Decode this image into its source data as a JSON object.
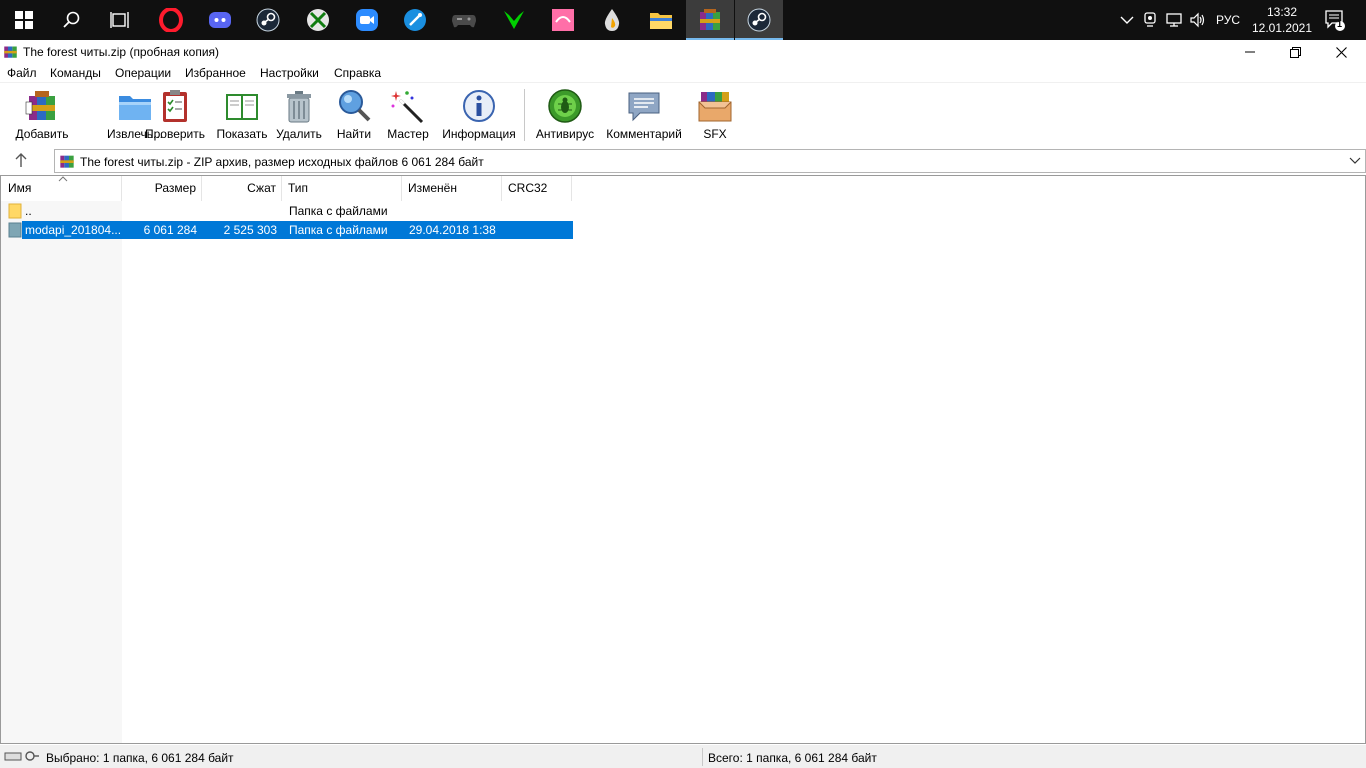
{
  "taskbar": {
    "apps": [
      {
        "name": "Opera",
        "color": "#ff1b2d"
      },
      {
        "name": "Discord",
        "color": "#5865f2"
      },
      {
        "name": "Steam",
        "color": "#1b2838"
      },
      {
        "name": "Xbox",
        "color": "#3a3a3a"
      },
      {
        "name": "Zoom",
        "color": "#2d8cff"
      },
      {
        "name": "Paint",
        "color": "#1a6ec2"
      },
      {
        "name": "Gamepad",
        "color": "#3a3a3a"
      },
      {
        "name": "Razer",
        "color": "#00c800"
      },
      {
        "name": "Chrome-alt",
        "color": "#ff66aa"
      },
      {
        "name": "Drop",
        "color": "#e8e8e8"
      },
      {
        "name": "Explorer",
        "color": "#f5c342"
      },
      {
        "name": "WinRAR",
        "color": "#8a2c8a"
      },
      {
        "name": "Steam",
        "color": "#1b2838"
      }
    ],
    "lang": "РУС",
    "time": "13:32",
    "date": "12.01.2021",
    "notif_count": "1"
  },
  "window": {
    "title": "The forest читы.zip (пробная копия)"
  },
  "menu": [
    "Файл",
    "Команды",
    "Операции",
    "Избранное",
    "Настройки",
    "Справка"
  ],
  "toolbar": [
    {
      "label": "Добавить",
      "icon": "add-archive-icon"
    },
    {
      "label": "Извлечь...",
      "icon": "extract-folder-icon"
    },
    {
      "label": "Проверить",
      "icon": "test-clipboard-icon"
    },
    {
      "label": "Показать",
      "icon": "view-book-icon"
    },
    {
      "label": "Удалить",
      "icon": "trash-icon"
    },
    {
      "label": "Найти",
      "icon": "magnifier-icon"
    },
    {
      "label": "Мастер",
      "icon": "wizard-wand-icon"
    },
    {
      "label": "Информация",
      "icon": "info-icon"
    },
    {
      "label": "Антивирус",
      "icon": "antivirus-bug-icon"
    },
    {
      "label": "Комментарий",
      "icon": "comment-icon"
    },
    {
      "label": "SFX",
      "icon": "sfx-box-icon"
    }
  ],
  "address": {
    "path": "The forest читы.zip - ZIP архив, размер исходных файлов 6 061 284 байт"
  },
  "columns": [
    "Имя",
    "Размер",
    "Сжат",
    "Тип",
    "Изменён",
    "CRC32"
  ],
  "rows": [
    {
      "name": "..",
      "size": "",
      "packed": "",
      "type": "Папка с файлами",
      "modified": "",
      "crc": ""
    },
    {
      "name": "modapi_201804...",
      "size": "6 061 284",
      "packed": "2 525 303",
      "type": "Папка с файлами",
      "modified": "29.04.2018 1:38",
      "crc": ""
    }
  ],
  "status": {
    "selected": "Выбрано: 1 папка, 6 061 284 байт",
    "total": "Всего: 1 папка, 6 061 284 байт"
  }
}
